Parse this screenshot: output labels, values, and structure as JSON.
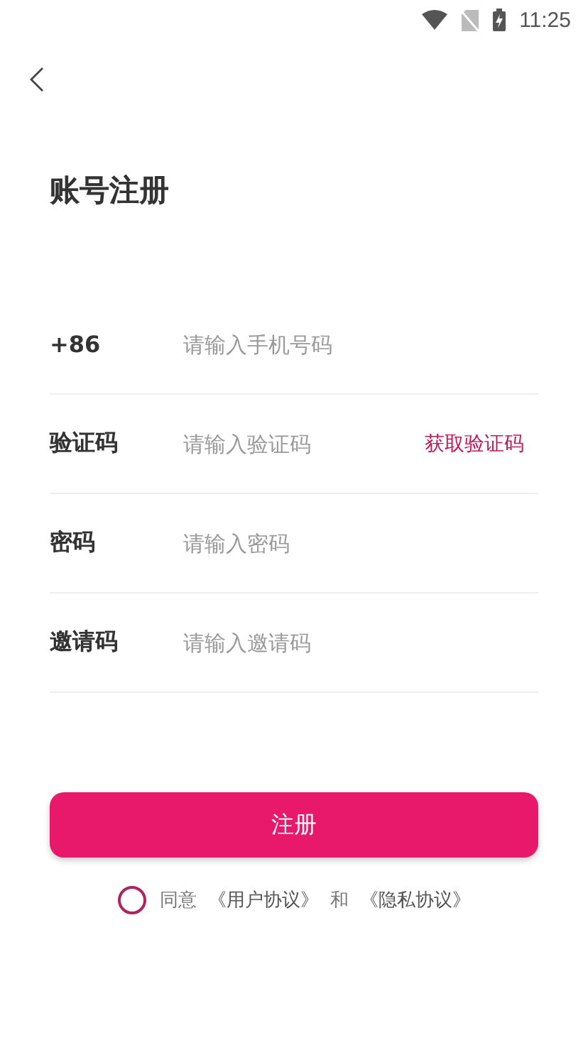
{
  "status_bar": {
    "time": "11:25"
  },
  "title": "账号注册",
  "fields": [
    {
      "label": "+86",
      "placeholder": "请输入手机号码"
    },
    {
      "label": "验证码",
      "placeholder": "请输入验证码",
      "action": "获取验证码"
    },
    {
      "label": "密码",
      "placeholder": "请输入密码"
    },
    {
      "label": "邀请码",
      "placeholder": "请输入邀请码"
    }
  ],
  "submit": "注册",
  "agreement": {
    "checked": false,
    "parts": [
      {
        "kind": "text",
        "text": "同意"
      },
      {
        "kind": "link",
        "text": "《用户协议》"
      },
      {
        "kind": "text",
        "text": "和"
      },
      {
        "kind": "link",
        "text": "《隐私协议》"
      }
    ]
  }
}
